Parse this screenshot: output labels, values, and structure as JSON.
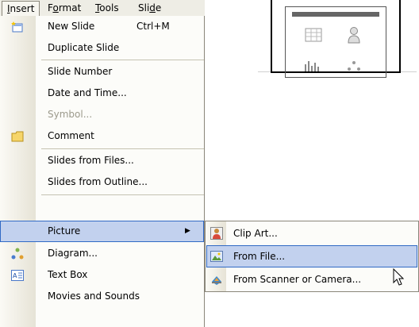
{
  "menubar": {
    "items": [
      {
        "label": "Insert",
        "mnemonic_index": 0
      },
      {
        "label": "Format",
        "mnemonic_index": 1
      },
      {
        "label": "Tools",
        "mnemonic_index": 0
      },
      {
        "label": "Slide",
        "mnemonic_index": 3
      }
    ],
    "active": "Insert"
  },
  "insert_menu": {
    "items": [
      {
        "label": "New Slide",
        "shortcut": "Ctrl+M",
        "icon": "new-slide-icon",
        "enabled": true
      },
      {
        "label": "Duplicate Slide",
        "enabled": true
      },
      {
        "label": "Slide Number",
        "enabled": true
      },
      {
        "label": "Date and Time...",
        "enabled": true
      },
      {
        "label": "Symbol...",
        "enabled": false
      },
      {
        "label": "Comment",
        "icon": "comment-icon",
        "enabled": true
      },
      {
        "label": "Slides from Files...",
        "enabled": true
      },
      {
        "label": "Slides from Outline...",
        "enabled": true
      },
      {
        "label": "Picture",
        "has_submenu": true,
        "highlighted": true,
        "enabled": true
      },
      {
        "label": "Diagram...",
        "icon": "diagram-icon",
        "enabled": true
      },
      {
        "label": "Text Box",
        "icon": "text-box-icon",
        "enabled": true
      },
      {
        "label": "Movies and Sounds",
        "enabled": true,
        "partially_visible": true
      }
    ]
  },
  "picture_submenu": {
    "items": [
      {
        "label": "Clip Art...",
        "icon": "clip-art-icon"
      },
      {
        "label": "From File...",
        "icon": "from-file-icon",
        "highlighted": true
      },
      {
        "label": "From Scanner or Camera...",
        "icon": "scanner-camera-icon"
      }
    ]
  },
  "colors": {
    "highlight_bg": "#c2d1ee",
    "highlight_border": "#316ac5",
    "menu_bg": "#fcfcf9",
    "menubar_bg": "#eeede5",
    "disabled_text": "#9c9a8c"
  }
}
